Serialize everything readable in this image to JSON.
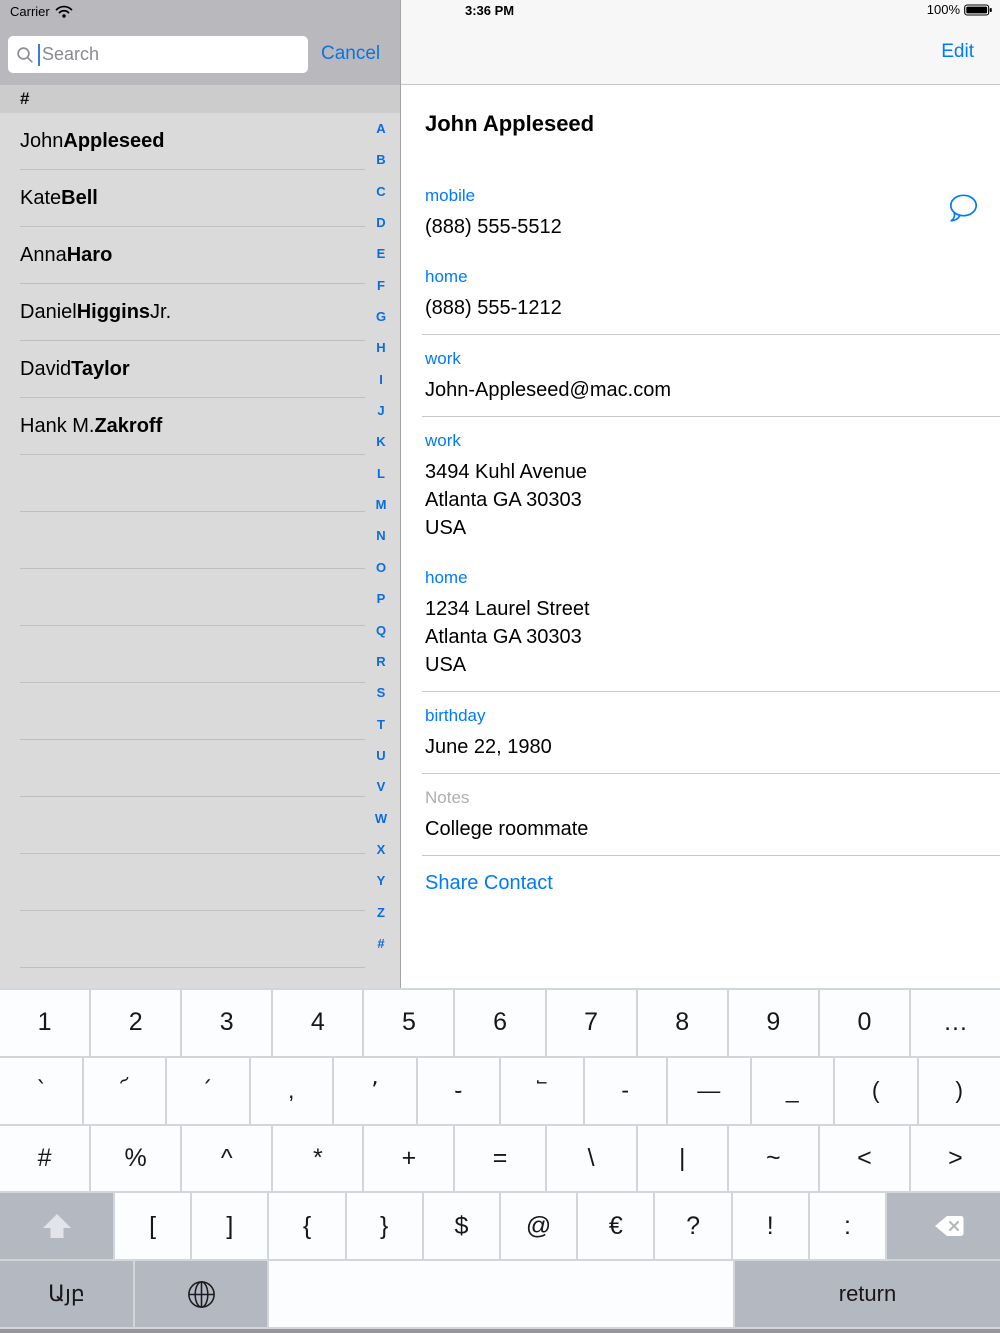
{
  "status_bar": {
    "carrier": "Carrier",
    "time": "3:36 PM",
    "battery": "100%"
  },
  "search": {
    "placeholder": "Search",
    "value": "",
    "cancel_label": "Cancel"
  },
  "nav": {
    "edit_label": "Edit"
  },
  "contact_list": {
    "section_header": "#",
    "contacts": [
      {
        "pre": "John ",
        "bold": "Appleseed",
        "post": ""
      },
      {
        "pre": "Kate ",
        "bold": "Bell",
        "post": ""
      },
      {
        "pre": "Anna ",
        "bold": "Haro",
        "post": ""
      },
      {
        "pre": "Daniel ",
        "bold": "Higgins",
        "post": " Jr."
      },
      {
        "pre": "David ",
        "bold": "Taylor",
        "post": ""
      },
      {
        "pre": "Hank M. ",
        "bold": "Zakroff",
        "post": ""
      }
    ],
    "empty_row_count": 9,
    "index": [
      "A",
      "B",
      "C",
      "D",
      "E",
      "F",
      "G",
      "H",
      "I",
      "J",
      "K",
      "L",
      "M",
      "N",
      "O",
      "P",
      "Q",
      "R",
      "S",
      "T",
      "U",
      "V",
      "W",
      "X",
      "Y",
      "Z",
      "#"
    ]
  },
  "detail": {
    "name": "John Appleseed",
    "fields": [
      {
        "label": "mobile",
        "type": "blue",
        "lines": [
          "(888) 555-5512"
        ],
        "icon": "message",
        "sep": false
      },
      {
        "label": "home",
        "type": "blue",
        "lines": [
          "(888) 555-1212"
        ],
        "sep": true
      },
      {
        "label": "work",
        "type": "blue",
        "lines": [
          "John-Appleseed@mac.com"
        ],
        "sep": true
      },
      {
        "label": "work",
        "type": "blue",
        "lines": [
          "3494 Kuhl Avenue",
          "Atlanta GA 30303",
          "USA"
        ],
        "sep": false
      },
      {
        "label": "home",
        "type": "blue",
        "lines": [
          "1234 Laurel Street",
          "Atlanta GA 30303",
          "USA"
        ],
        "sep": true
      },
      {
        "label": "birthday",
        "type": "blue",
        "lines": [
          "June 22, 1980"
        ],
        "sep": true
      },
      {
        "label": "Notes",
        "type": "gray",
        "lines": [
          "College roommate"
        ],
        "sep": true
      }
    ],
    "share_label": "Share Contact"
  },
  "keyboard": {
    "row1": [
      "1",
      "2",
      "3",
      "4",
      "5",
      "6",
      "7",
      "8",
      "9",
      "0",
      "…"
    ],
    "row2": [
      "՝",
      "՜",
      "՛",
      ",",
      "՚",
      "֊",
      "՟",
      "-",
      "—",
      "_",
      "(",
      ")"
    ],
    "row3": [
      "#",
      "%",
      "^",
      "*",
      "+",
      "=",
      "\\",
      "|",
      "~",
      "<",
      ">"
    ],
    "row4": [
      "[",
      "]",
      "{",
      "}",
      "$",
      "@",
      "€",
      "?",
      "!",
      ":"
    ],
    "abc_key": "Այբ",
    "space_key": "",
    "return_key": "return"
  },
  "colors": {
    "accent_blue": "#007aff",
    "left_pane_bg": "#dadada",
    "left_bar_bg": "#b9b9bd",
    "right_bar_bg": "#f7f7f7",
    "key_white": "#fcfdfe",
    "key_gray": "#b4b8c1",
    "separator": "#c9c8cd"
  }
}
